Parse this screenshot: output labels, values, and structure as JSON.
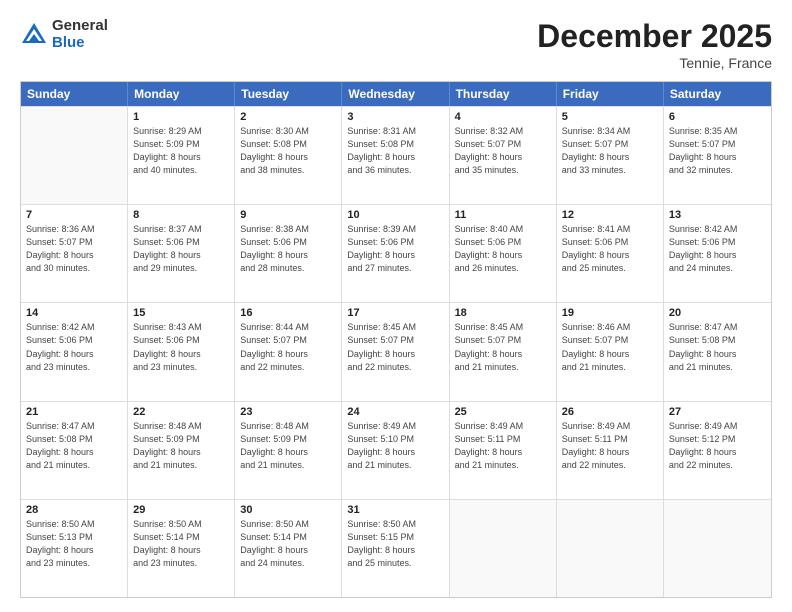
{
  "logo": {
    "general": "General",
    "blue": "Blue"
  },
  "header": {
    "month": "December 2025",
    "location": "Tennie, France"
  },
  "weekdays": [
    "Sunday",
    "Monday",
    "Tuesday",
    "Wednesday",
    "Thursday",
    "Friday",
    "Saturday"
  ],
  "weeks": [
    [
      {
        "day": "",
        "empty": true
      },
      {
        "day": "1",
        "sunrise": "Sunrise: 8:29 AM",
        "sunset": "Sunset: 5:09 PM",
        "daylight": "Daylight: 8 hours",
        "daylight2": "and 40 minutes."
      },
      {
        "day": "2",
        "sunrise": "Sunrise: 8:30 AM",
        "sunset": "Sunset: 5:08 PM",
        "daylight": "Daylight: 8 hours",
        "daylight2": "and 38 minutes."
      },
      {
        "day": "3",
        "sunrise": "Sunrise: 8:31 AM",
        "sunset": "Sunset: 5:08 PM",
        "daylight": "Daylight: 8 hours",
        "daylight2": "and 36 minutes."
      },
      {
        "day": "4",
        "sunrise": "Sunrise: 8:32 AM",
        "sunset": "Sunset: 5:07 PM",
        "daylight": "Daylight: 8 hours",
        "daylight2": "and 35 minutes."
      },
      {
        "day": "5",
        "sunrise": "Sunrise: 8:34 AM",
        "sunset": "Sunset: 5:07 PM",
        "daylight": "Daylight: 8 hours",
        "daylight2": "and 33 minutes."
      },
      {
        "day": "6",
        "sunrise": "Sunrise: 8:35 AM",
        "sunset": "Sunset: 5:07 PM",
        "daylight": "Daylight: 8 hours",
        "daylight2": "and 32 minutes."
      }
    ],
    [
      {
        "day": "7",
        "sunrise": "Sunrise: 8:36 AM",
        "sunset": "Sunset: 5:07 PM",
        "daylight": "Daylight: 8 hours",
        "daylight2": "and 30 minutes."
      },
      {
        "day": "8",
        "sunrise": "Sunrise: 8:37 AM",
        "sunset": "Sunset: 5:06 PM",
        "daylight": "Daylight: 8 hours",
        "daylight2": "and 29 minutes."
      },
      {
        "day": "9",
        "sunrise": "Sunrise: 8:38 AM",
        "sunset": "Sunset: 5:06 PM",
        "daylight": "Daylight: 8 hours",
        "daylight2": "and 28 minutes."
      },
      {
        "day": "10",
        "sunrise": "Sunrise: 8:39 AM",
        "sunset": "Sunset: 5:06 PM",
        "daylight": "Daylight: 8 hours",
        "daylight2": "and 27 minutes."
      },
      {
        "day": "11",
        "sunrise": "Sunrise: 8:40 AM",
        "sunset": "Sunset: 5:06 PM",
        "daylight": "Daylight: 8 hours",
        "daylight2": "and 26 minutes."
      },
      {
        "day": "12",
        "sunrise": "Sunrise: 8:41 AM",
        "sunset": "Sunset: 5:06 PM",
        "daylight": "Daylight: 8 hours",
        "daylight2": "and 25 minutes."
      },
      {
        "day": "13",
        "sunrise": "Sunrise: 8:42 AM",
        "sunset": "Sunset: 5:06 PM",
        "daylight": "Daylight: 8 hours",
        "daylight2": "and 24 minutes."
      }
    ],
    [
      {
        "day": "14",
        "sunrise": "Sunrise: 8:42 AM",
        "sunset": "Sunset: 5:06 PM",
        "daylight": "Daylight: 8 hours",
        "daylight2": "and 23 minutes."
      },
      {
        "day": "15",
        "sunrise": "Sunrise: 8:43 AM",
        "sunset": "Sunset: 5:06 PM",
        "daylight": "Daylight: 8 hours",
        "daylight2": "and 23 minutes."
      },
      {
        "day": "16",
        "sunrise": "Sunrise: 8:44 AM",
        "sunset": "Sunset: 5:07 PM",
        "daylight": "Daylight: 8 hours",
        "daylight2": "and 22 minutes."
      },
      {
        "day": "17",
        "sunrise": "Sunrise: 8:45 AM",
        "sunset": "Sunset: 5:07 PM",
        "daylight": "Daylight: 8 hours",
        "daylight2": "and 22 minutes."
      },
      {
        "day": "18",
        "sunrise": "Sunrise: 8:45 AM",
        "sunset": "Sunset: 5:07 PM",
        "daylight": "Daylight: 8 hours",
        "daylight2": "and 21 minutes."
      },
      {
        "day": "19",
        "sunrise": "Sunrise: 8:46 AM",
        "sunset": "Sunset: 5:07 PM",
        "daylight": "Daylight: 8 hours",
        "daylight2": "and 21 minutes."
      },
      {
        "day": "20",
        "sunrise": "Sunrise: 8:47 AM",
        "sunset": "Sunset: 5:08 PM",
        "daylight": "Daylight: 8 hours",
        "daylight2": "and 21 minutes."
      }
    ],
    [
      {
        "day": "21",
        "sunrise": "Sunrise: 8:47 AM",
        "sunset": "Sunset: 5:08 PM",
        "daylight": "Daylight: 8 hours",
        "daylight2": "and 21 minutes."
      },
      {
        "day": "22",
        "sunrise": "Sunrise: 8:48 AM",
        "sunset": "Sunset: 5:09 PM",
        "daylight": "Daylight: 8 hours",
        "daylight2": "and 21 minutes."
      },
      {
        "day": "23",
        "sunrise": "Sunrise: 8:48 AM",
        "sunset": "Sunset: 5:09 PM",
        "daylight": "Daylight: 8 hours",
        "daylight2": "and 21 minutes."
      },
      {
        "day": "24",
        "sunrise": "Sunrise: 8:49 AM",
        "sunset": "Sunset: 5:10 PM",
        "daylight": "Daylight: 8 hours",
        "daylight2": "and 21 minutes."
      },
      {
        "day": "25",
        "sunrise": "Sunrise: 8:49 AM",
        "sunset": "Sunset: 5:11 PM",
        "daylight": "Daylight: 8 hours",
        "daylight2": "and 21 minutes."
      },
      {
        "day": "26",
        "sunrise": "Sunrise: 8:49 AM",
        "sunset": "Sunset: 5:11 PM",
        "daylight": "Daylight: 8 hours",
        "daylight2": "and 22 minutes."
      },
      {
        "day": "27",
        "sunrise": "Sunrise: 8:49 AM",
        "sunset": "Sunset: 5:12 PM",
        "daylight": "Daylight: 8 hours",
        "daylight2": "and 22 minutes."
      }
    ],
    [
      {
        "day": "28",
        "sunrise": "Sunrise: 8:50 AM",
        "sunset": "Sunset: 5:13 PM",
        "daylight": "Daylight: 8 hours",
        "daylight2": "and 23 minutes."
      },
      {
        "day": "29",
        "sunrise": "Sunrise: 8:50 AM",
        "sunset": "Sunset: 5:14 PM",
        "daylight": "Daylight: 8 hours",
        "daylight2": "and 23 minutes."
      },
      {
        "day": "30",
        "sunrise": "Sunrise: 8:50 AM",
        "sunset": "Sunset: 5:14 PM",
        "daylight": "Daylight: 8 hours",
        "daylight2": "and 24 minutes."
      },
      {
        "day": "31",
        "sunrise": "Sunrise: 8:50 AM",
        "sunset": "Sunset: 5:15 PM",
        "daylight": "Daylight: 8 hours",
        "daylight2": "and 25 minutes."
      },
      {
        "day": "",
        "empty": true
      },
      {
        "day": "",
        "empty": true
      },
      {
        "day": "",
        "empty": true
      }
    ]
  ]
}
